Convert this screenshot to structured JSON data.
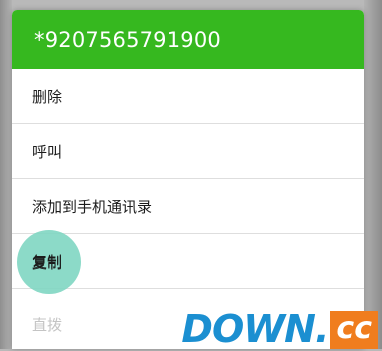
{
  "dialog": {
    "title": "*9207565791900",
    "items": [
      {
        "label": "删除"
      },
      {
        "label": "呼叫"
      },
      {
        "label": "添加到手机通讯录"
      },
      {
        "label": "复制"
      },
      {
        "label": "直拨"
      }
    ]
  },
  "watermark": {
    "main": "DOWN.",
    "tld": "cc"
  },
  "colors": {
    "header": "#36b81f",
    "touch_ripple": "#7fd6c2",
    "watermark_blue": "#1b8fd1",
    "watermark_orange": "#f07d1e"
  }
}
